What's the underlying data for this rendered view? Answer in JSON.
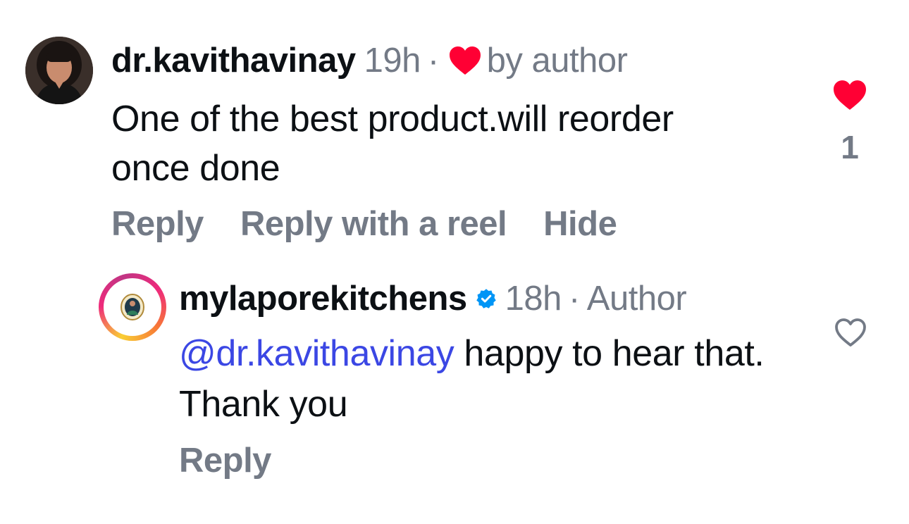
{
  "comments": [
    {
      "username": "dr.kavithavinay",
      "time": "19h",
      "separator": "·",
      "liked_by_author_label": "by author",
      "text": "One of the best product.will reorder once done",
      "actions": {
        "reply": "Reply",
        "reply_with_reel": "Reply with a reel",
        "hide": "Hide"
      },
      "like_count": "1",
      "liked": true,
      "icons": {
        "author_heart": "heart-filled-icon",
        "like": "heart-filled-icon"
      }
    }
  ],
  "reply": {
    "username": "mylaporekitchens",
    "verified": true,
    "time": "18h",
    "separator": "·",
    "role": "Author",
    "mention": "@dr.kavithavinay",
    "text": " happy to hear that. Thank you",
    "actions": {
      "reply": "Reply"
    },
    "liked": false,
    "icons": {
      "verified": "verified-badge-icon",
      "like": "heart-outline-icon"
    }
  },
  "colors": {
    "text": "#0c1014",
    "muted": "#737a86",
    "heart": "#ff0034",
    "mention": "#3b47e4",
    "verified": "#0095f6"
  }
}
